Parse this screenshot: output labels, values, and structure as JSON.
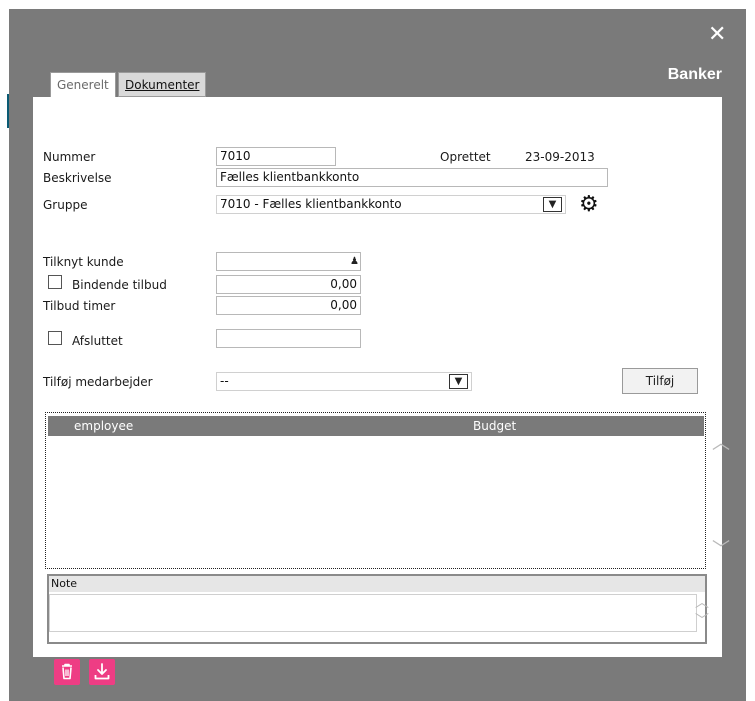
{
  "window": {
    "title": "Banker",
    "close_icon": "close-icon"
  },
  "tabs": [
    {
      "label": "Generelt",
      "active": true
    },
    {
      "label": "Dokumenter",
      "active": false
    }
  ],
  "form": {
    "nummer": {
      "label": "Nummer",
      "value": "7010"
    },
    "oprettet": {
      "label": "Oprettet",
      "value": "23-09-2013"
    },
    "beskrivelse": {
      "label": "Beskrivelse",
      "value": "Fælles klientbankkonto"
    },
    "gruppe": {
      "label": "Gruppe",
      "value": "7010 - Fælles klientbankkonto",
      "settings_icon": "gear-icon"
    },
    "tilknyt_kunde": {
      "label": "Tilknyt kunde",
      "value": "",
      "icon": "user-icon"
    },
    "bindende_tilbud": {
      "label": "Bindende tilbud",
      "checked": false,
      "value": "0,00"
    },
    "tilbud_timer": {
      "label": "Tilbud timer",
      "value": "0,00"
    },
    "afsluttet": {
      "label": "Afsluttet",
      "checked": false,
      "value": ""
    },
    "tilfoej_medarbejder": {
      "label": "Tilføj medarbejder",
      "value": "--"
    },
    "add_button": "Tilføj"
  },
  "grid": {
    "columns": [
      "employee",
      "Budget"
    ],
    "rows": []
  },
  "note": {
    "label": "Note",
    "value": ""
  },
  "actions": {
    "delete_icon": "trash-icon",
    "download_icon": "download-icon",
    "color": "#ee3d84"
  }
}
